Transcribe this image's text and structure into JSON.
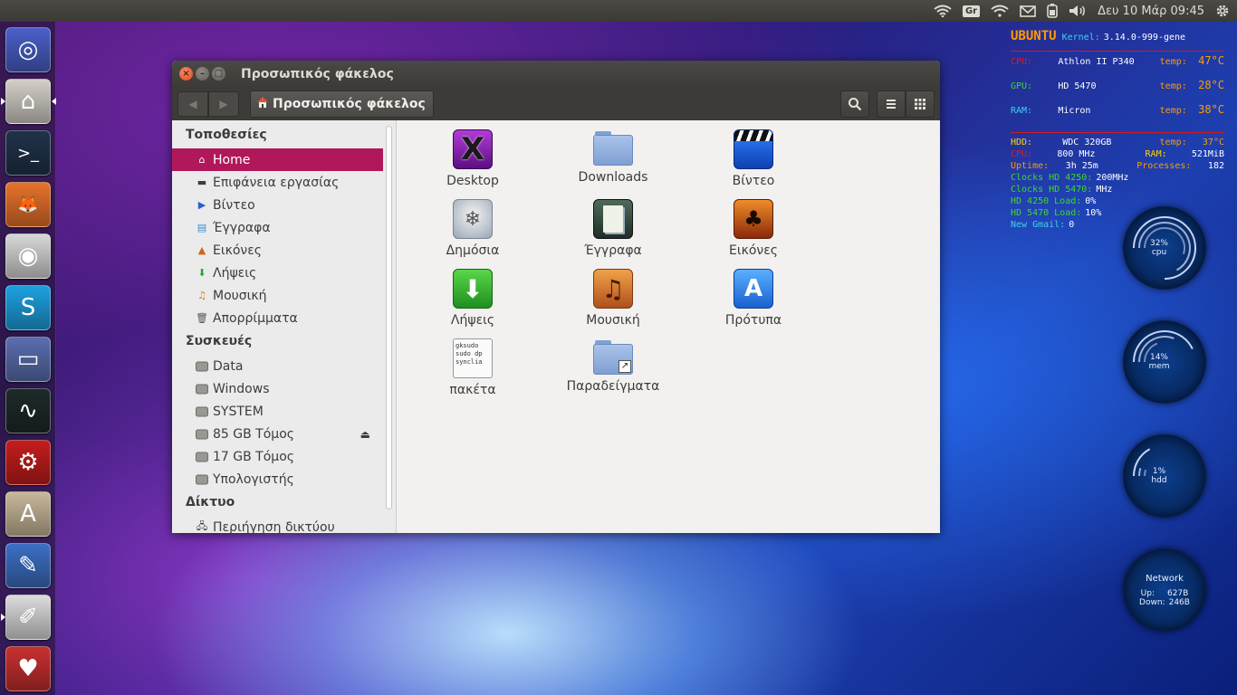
{
  "topbar": {
    "keyboard_layout": "Gr",
    "clock": "Δευ 10 Μάρ 09:45"
  },
  "launcher": {
    "items": [
      {
        "name": "ubuntu-dash",
        "glyph": "◎",
        "bg": "#4a60c8"
      },
      {
        "name": "home-folder",
        "glyph": "⌂",
        "bg": "#d4d0c8"
      },
      {
        "name": "terminal",
        "glyph": ">_",
        "bg": "#20324a"
      },
      {
        "name": "firefox",
        "glyph": "🦊",
        "bg": "#e8722a"
      },
      {
        "name": "chrome",
        "glyph": "◉",
        "bg": "#d8d8d8"
      },
      {
        "name": "skype",
        "glyph": "S",
        "bg": "#1da1e0"
      },
      {
        "name": "disks",
        "glyph": "▭",
        "bg": "#5a6fb0"
      },
      {
        "name": "system-monitor",
        "glyph": "∿",
        "bg": "#1e2a2a"
      },
      {
        "name": "software-center-red",
        "glyph": "⚙",
        "bg": "#c41d1d"
      },
      {
        "name": "software-updater",
        "glyph": "A",
        "bg": "#c8b89a"
      },
      {
        "name": "tool-app",
        "glyph": "✎",
        "bg": "#3d6fc4"
      },
      {
        "name": "text-editor",
        "glyph": "✐",
        "bg": "#dcdcdc"
      },
      {
        "name": "cards-game",
        "glyph": "♥",
        "bg": "#c83030"
      },
      {
        "name": "more-apps",
        "glyph": "▦",
        "bg": "#2b3e8a"
      }
    ]
  },
  "window": {
    "title": "Προσωπικός φάκελος",
    "breadcrumb": "Προσωπικός φάκελος",
    "sidebar": {
      "places_header": "Τοποθεσίες",
      "places": [
        {
          "label": "Home",
          "icon": "home-icon",
          "active": true
        },
        {
          "label": "Επιφάνεια εργασίας",
          "icon": "desktop-folder-icon"
        },
        {
          "label": "Βίντεο",
          "icon": "video-icon"
        },
        {
          "label": "Έγγραφα",
          "icon": "documents-icon"
        },
        {
          "label": "Εικόνες",
          "icon": "pictures-icon"
        },
        {
          "label": "Λήψεις",
          "icon": "downloads-icon"
        },
        {
          "label": "Μουσική",
          "icon": "music-icon"
        },
        {
          "label": "Απορρίμματα",
          "icon": "trash-icon"
        }
      ],
      "devices_header": "Συσκευές",
      "devices": [
        {
          "label": "Data"
        },
        {
          "label": "Windows"
        },
        {
          "label": "SYSTEM"
        },
        {
          "label": "85 GB Τόμος",
          "eject": true
        },
        {
          "label": "17 GB Τόμος"
        },
        {
          "label": "Υπολογιστής"
        }
      ],
      "network_header": "Δίκτυο",
      "network_partial": "Περιήγηση δικτύου"
    },
    "files": [
      {
        "label": "Desktop",
        "kind": "desktop"
      },
      {
        "label": "Downloads",
        "kind": "folder"
      },
      {
        "label": "Βίντεο",
        "kind": "video"
      },
      {
        "label": "Δημόσια",
        "kind": "public"
      },
      {
        "label": "Έγγραφα",
        "kind": "documents"
      },
      {
        "label": "Εικόνες",
        "kind": "pictures"
      },
      {
        "label": "Λήψεις",
        "kind": "downloads"
      },
      {
        "label": "Μουσική",
        "kind": "music"
      },
      {
        "label": "Πρότυπα",
        "kind": "templates"
      },
      {
        "label": "πακέτα",
        "kind": "script",
        "preview": "gksudo\nsudo dp\nsynclia"
      },
      {
        "label": "Παραδείγματα",
        "kind": "folder-link"
      }
    ]
  },
  "conky": {
    "header": {
      "os": "UBUNTU",
      "kernel_label": "Kernel:",
      "kernel": "3.14.0-999-gene"
    },
    "cpu": {
      "label": "CPU:",
      "model": "Athlon II P340",
      "temp_label": "temp:",
      "temp": "47°C"
    },
    "gpu": {
      "label": "GPU:",
      "model": "HD 5470",
      "temp_label": "temp:",
      "temp": "28°C"
    },
    "ram": {
      "label": "RAM:",
      "model": "Micron",
      "temp_label": "temp:",
      "temp": "38°C"
    },
    "hdd": {
      "label": "HDD:",
      "model": "WDC 320GB",
      "temp_label": "temp:",
      "temp": "37°C"
    },
    "cpu_freq": {
      "label": "CPU:",
      "value": "800 MHz",
      "ram_label": "RAM:",
      "ram_value": "521MiB"
    },
    "uptime": {
      "label": "Uptime:",
      "value": "3h 25m",
      "proc_label": "Processes:",
      "proc_value": "182"
    },
    "clocks_4250": {
      "label": "Clocks HD 4250:",
      "value": "200MHz"
    },
    "clocks_5470": {
      "label": "Clocks HD 5470:",
      "value": "MHz"
    },
    "load_4250": {
      "label": "HD 4250 Load:",
      "value": "0%"
    },
    "load_5470": {
      "label": "HD 5470 Load:",
      "value": "10%"
    },
    "gmail": {
      "label": "New Gmail:",
      "value": "0"
    },
    "gauges": [
      {
        "value": "32%",
        "label": "cpu",
        "fraction": 0.32
      },
      {
        "value": "14%",
        "label": "mem",
        "fraction": 0.14
      },
      {
        "value": "1%",
        "label": "hdd",
        "fraction": 0.01
      }
    ],
    "network": {
      "title": "Network",
      "up_label": "Up:",
      "up": "627B",
      "down_label": "Down:",
      "down": "246B"
    },
    "colors": {
      "orange": "#ff9a00",
      "red": "#e01b1b",
      "green": "#3fd62a",
      "cyan": "#3fd0f0",
      "yellow": "#ffd500",
      "white": "#ffffff"
    }
  }
}
